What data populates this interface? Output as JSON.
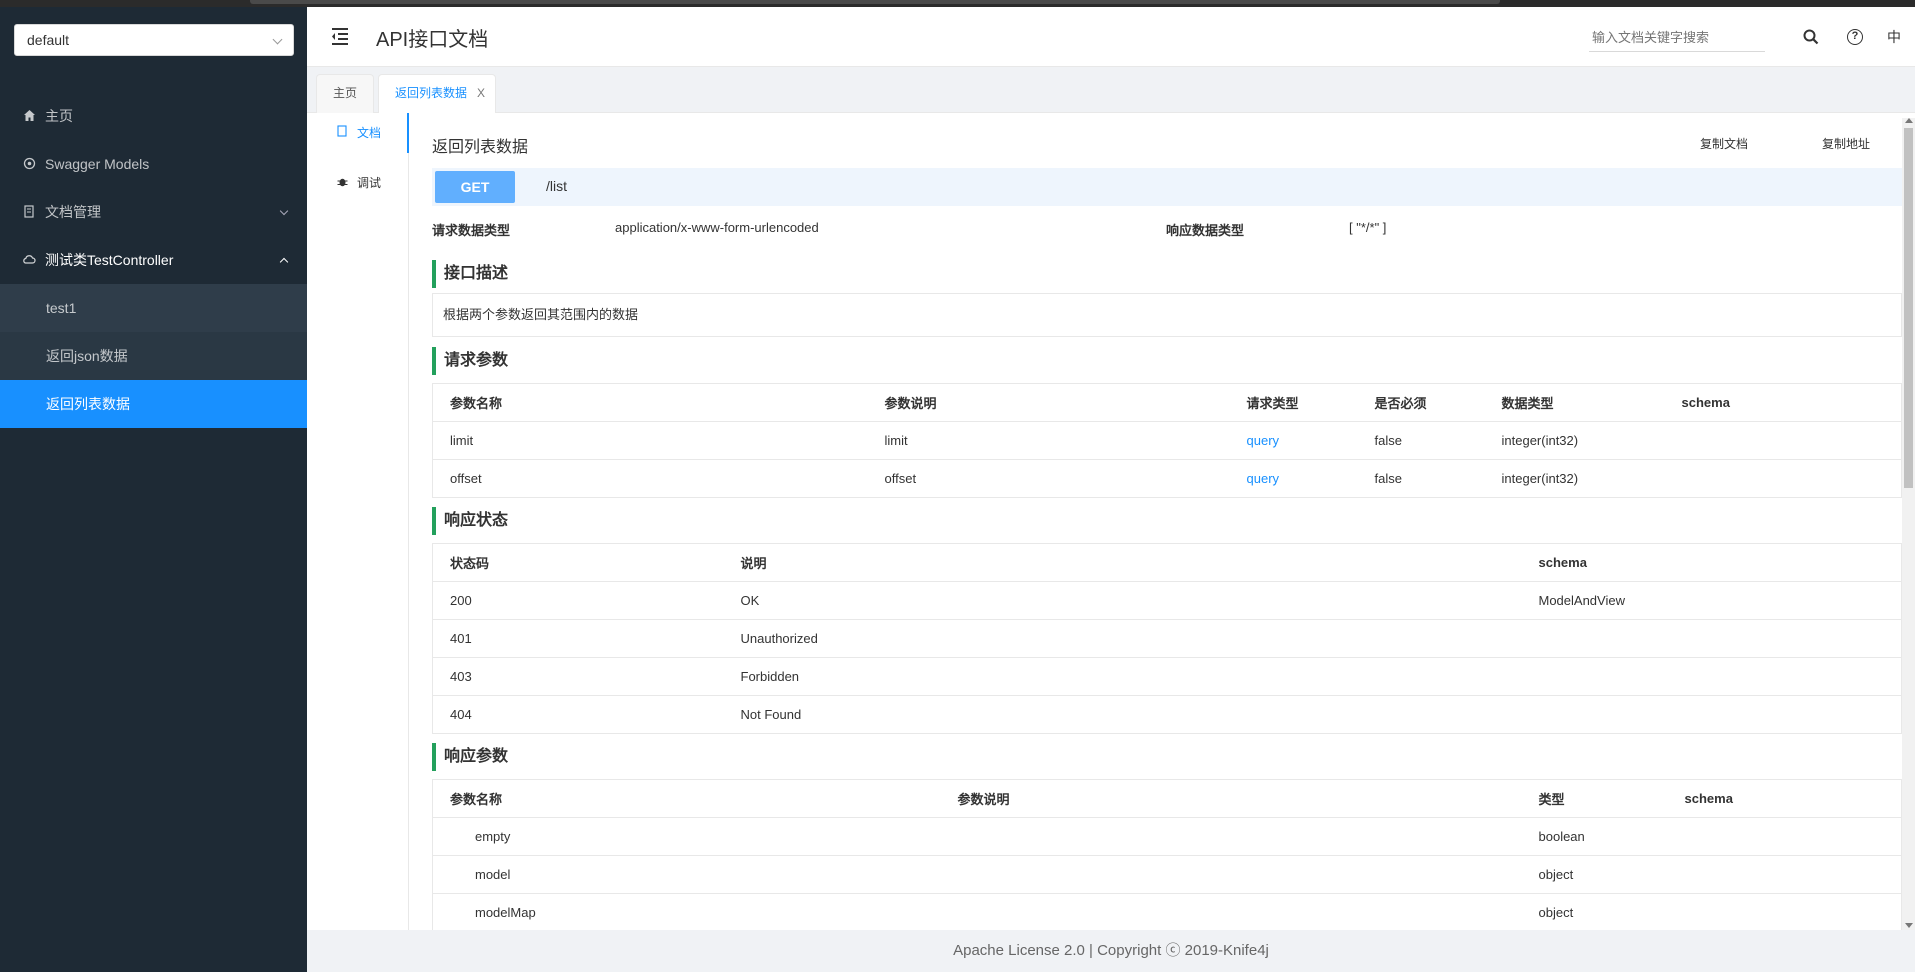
{
  "group_select": {
    "value": "default"
  },
  "sidebar": {
    "items": [
      {
        "label": "主页",
        "icon": "home-icon"
      },
      {
        "label": "Swagger Models",
        "icon": "models-icon"
      },
      {
        "label": "文档管理",
        "icon": "docs-icon"
      },
      {
        "label": "测试类TestController",
        "icon": "cloud-icon"
      }
    ],
    "subitems": [
      {
        "label": "test1"
      },
      {
        "label": "返回json数据"
      },
      {
        "label": "返回列表数据"
      }
    ]
  },
  "header": {
    "title": "API接口文档",
    "search_placeholder": "输入文档关键字搜索",
    "lang": "中"
  },
  "tabs": [
    {
      "label": "主页"
    },
    {
      "label": "返回列表数据",
      "close": "X"
    }
  ],
  "side_tabs": [
    {
      "label": "文档"
    },
    {
      "label": "调试"
    }
  ],
  "doc": {
    "title": "返回列表数据",
    "copy_doc": "复制文档",
    "copy_addr": "复制地址",
    "method": "GET",
    "path": "/list",
    "req_type_label": "请求数据类型",
    "req_type_value": "application/x-www-form-urlencoded",
    "resp_type_label": "响应数据类型",
    "resp_type_value": "[ \"*/*\" ]",
    "desc_header": "接口描述",
    "desc_text": "根据两个参数返回其范围内的数据",
    "req_params_header": "请求参数",
    "req_params_cols": [
      "参数名称",
      "参数说明",
      "请求类型",
      "是否必须",
      "数据类型",
      "schema"
    ],
    "req_params_rows": [
      [
        "limit",
        "limit",
        "query",
        "false",
        "integer(int32)",
        ""
      ],
      [
        "offset",
        "offset",
        "query",
        "false",
        "integer(int32)",
        ""
      ]
    ],
    "resp_status_header": "响应状态",
    "resp_status_cols": [
      "状态码",
      "说明",
      "schema"
    ],
    "resp_status_rows": [
      [
        "200",
        "OK",
        "ModelAndView"
      ],
      [
        "401",
        "Unauthorized",
        ""
      ],
      [
        "403",
        "Forbidden",
        ""
      ],
      [
        "404",
        "Not Found",
        ""
      ]
    ],
    "resp_params_header": "响应参数",
    "resp_params_cols": [
      "参数名称",
      "参数说明",
      "类型",
      "schema"
    ],
    "resp_params_rows": [
      [
        "empty",
        "",
        "boolean",
        ""
      ],
      [
        "model",
        "",
        "object",
        ""
      ],
      [
        "modelMap",
        "",
        "object",
        ""
      ]
    ]
  },
  "footer": {
    "text": "Apache License 2.0 | Copyright ⓒ 2019-Knife4j"
  },
  "colors": {
    "accent": "#1890ff",
    "get": "#61affe",
    "section_bar": "#23a05c",
    "sidebar_bg": "#1e2a35"
  }
}
